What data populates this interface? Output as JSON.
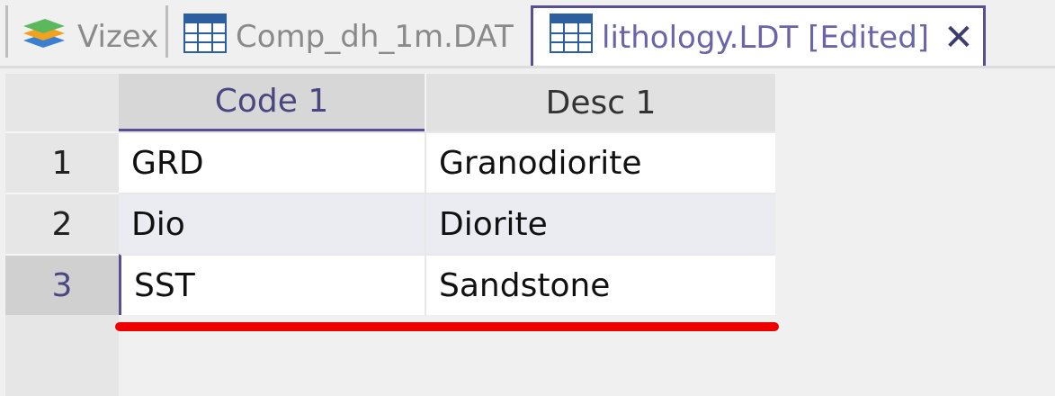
{
  "tabs": [
    {
      "label": "Vizex",
      "icon": "layers-icon",
      "active": false
    },
    {
      "label": "Comp_dh_1m.DAT",
      "icon": "table-icon",
      "active": false
    },
    {
      "label": "lithology.LDT [Edited]",
      "icon": "table-icon",
      "active": true,
      "close": "✕"
    }
  ],
  "grid": {
    "columns": [
      "Code 1",
      "Desc 1"
    ],
    "rows": [
      {
        "num": "1",
        "code": "GRD",
        "desc": "Granodiorite"
      },
      {
        "num": "2",
        "code": "Dio",
        "desc": "Diorite"
      },
      {
        "num": "3",
        "code": "SST",
        "desc": "Sandstone"
      }
    ]
  },
  "colors": {
    "accent": "#5a4e94",
    "annotation": "#ee0000"
  }
}
